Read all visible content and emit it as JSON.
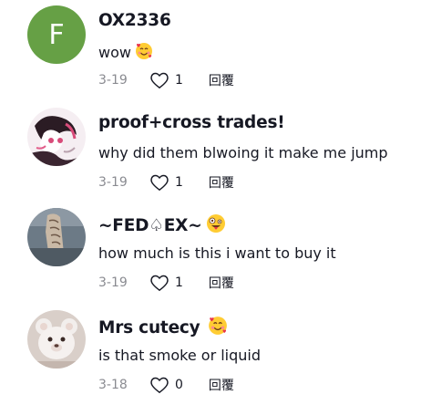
{
  "comments": [
    {
      "avatar_letter": "F",
      "username": "OX2336",
      "username_emoji": "",
      "text": "wow",
      "text_emoji": "smiling-face-with-hearts",
      "date": "3-19",
      "likes": "1",
      "reply_label": "回覆"
    },
    {
      "avatar_letter": "",
      "username": "proof+cross trades!",
      "username_emoji": "",
      "text": "why did them blwoing it make me jump",
      "text_emoji": "",
      "date": "3-19",
      "likes": "1",
      "reply_label": "回覆"
    },
    {
      "avatar_letter": "",
      "username": "~FED♤EX~",
      "username_emoji": "zany-face",
      "text": "how much is this i want to buy it",
      "text_emoji": "",
      "date": "3-19",
      "likes": "1",
      "reply_label": "回覆"
    },
    {
      "avatar_letter": "",
      "username": "Mrs cutecy",
      "username_emoji": "smiling-face-with-hearts",
      "text": "is that smoke or liquid",
      "text_emoji": "",
      "date": "3-18",
      "likes": "0",
      "reply_label": "回覆"
    }
  ],
  "colors": {
    "text_primary": "#161823",
    "text_secondary": "#8a8b91",
    "avatar_letter_bg": "#66a045"
  }
}
